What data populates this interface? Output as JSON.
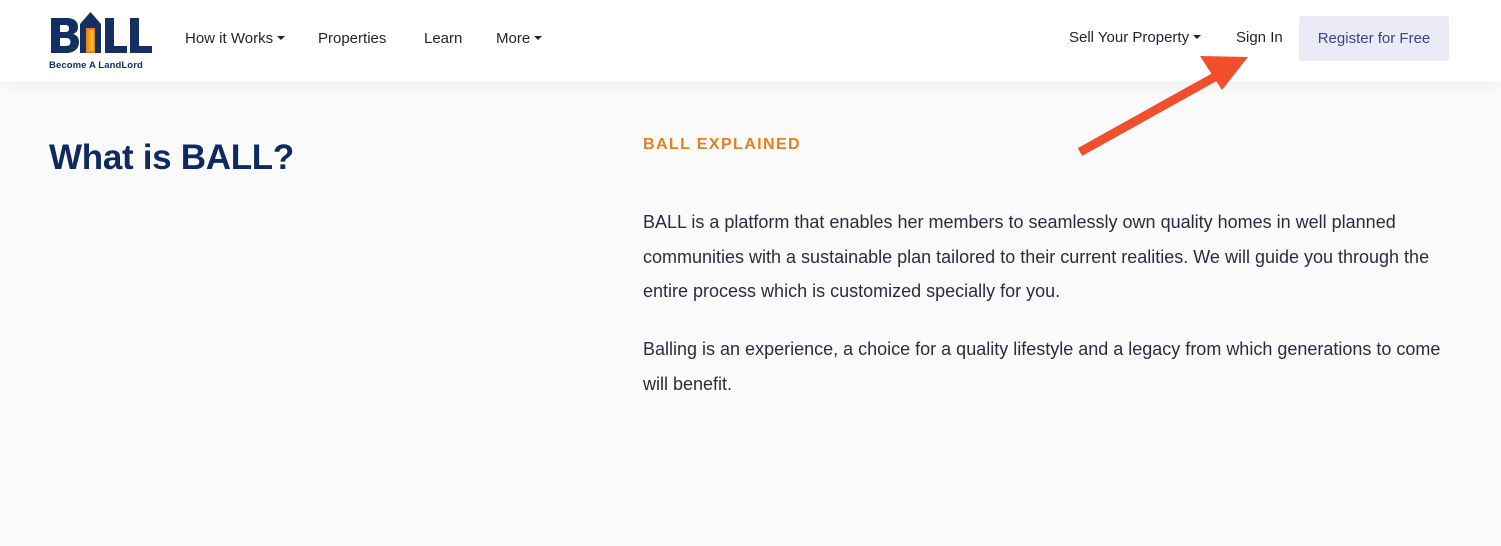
{
  "brand": {
    "logo_text": "BALL",
    "tagline": "Become A LandLord",
    "colors": {
      "navy": "#143063",
      "orange": "#ea7d1c",
      "yellow": "#f6c22a"
    }
  },
  "nav": {
    "left_items": [
      {
        "label": "How it Works",
        "has_dropdown": true
      },
      {
        "label": "Properties",
        "has_dropdown": false
      },
      {
        "label": "Learn",
        "has_dropdown": false
      },
      {
        "label": "More",
        "has_dropdown": true
      }
    ],
    "sell_property": {
      "label": "Sell Your Property",
      "has_dropdown": true
    },
    "sign_in": "Sign In",
    "register": "Register for Free"
  },
  "main": {
    "title": "What is BALL?",
    "eyebrow": "BALL EXPLAINED",
    "paragraphs": [
      "BALL is a platform that enables her members to seamlessly own quality homes in well planned communities with a sustainable plan tailored to their current realities. We will guide you through the entire process which is customized specially for you.",
      "Balling is an experience, a choice for a quality lifestyle and a legacy from which generations to come will benefit."
    ]
  },
  "annotation": {
    "arrow_color": "#f04e2c",
    "arrow_icon": "annotation-arrow-icon"
  }
}
